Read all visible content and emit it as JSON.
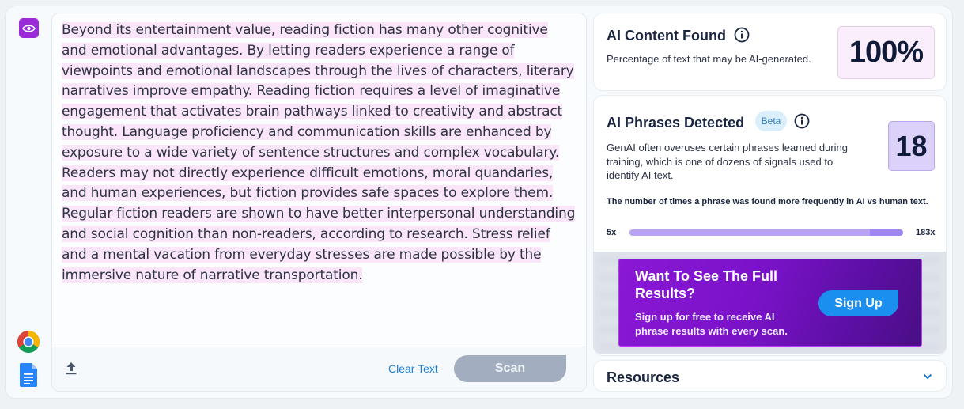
{
  "editor": {
    "paragraph": "Beyond its entertainment value, reading fiction has many other cognitive and emotional advantages. By letting readers experience a range of viewpoints and emotional landscapes through the lives of characters, literary narratives improve empathy. Reading fiction requires a level of imaginative engagement that activates brain pathways linked to creativity and abstract thought. Language proficiency and communication skills are enhanced by exposure to a wide variety of sentence structures and complex vocabulary. Readers may not directly experience difficult emotions, moral quandaries, and human experiences, but fiction provides safe spaces to explore them. Regular fiction readers are shown to have better interpersonal understanding and social cognition than non-readers, according to research. Stress relief and a mental vacation from everyday stresses are made possible by the immersive nature of narrative transportation.",
    "clear_label": "Clear Text",
    "scan_label": "Scan"
  },
  "ai_content": {
    "title": "AI Content Found",
    "description": "Percentage of text that may be AI-generated.",
    "percentage": "100%"
  },
  "ai_phrases": {
    "title": "AI Phrases Detected",
    "badge": "Beta",
    "description": "GenAI often overuses certain phrases learned during training, which is one of dozens of signals used to identify AI text.",
    "count": "18",
    "frequency_note": "The number of times a phrase was found more frequently in AI vs human text.",
    "range_min": "5x",
    "range_max": "183x"
  },
  "promo": {
    "title": "Want To See The Full Results?",
    "subtitle": "Sign up for free to receive AI phrase results with every scan.",
    "button_label": "Sign Up"
  },
  "resources": {
    "title": "Resources"
  },
  "colors": {
    "brand_purple": "#9b2bd8",
    "highlight": "#fae6f8",
    "link_blue": "#1d7fd1",
    "signup_blue": "#1b8ff0"
  },
  "icons": [
    "eye-icon",
    "chrome-icon",
    "google-docs-icon",
    "upload-icon",
    "info-icon",
    "chevron-down-icon"
  ]
}
